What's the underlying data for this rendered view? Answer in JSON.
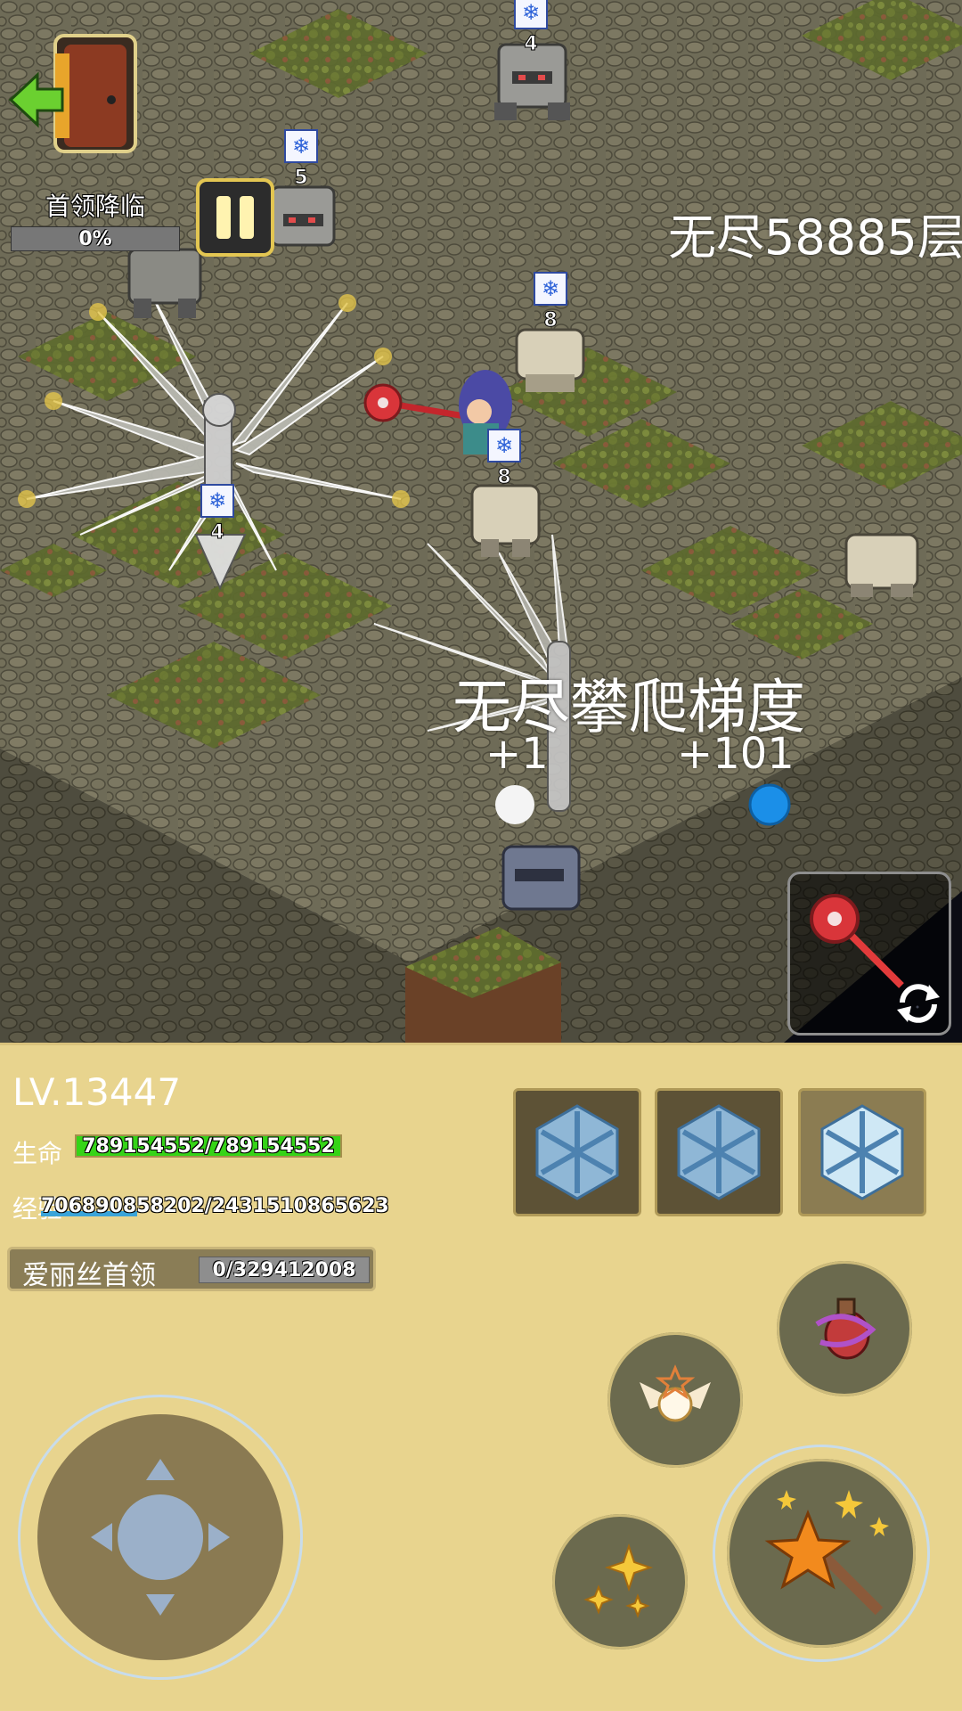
{
  "hud": {
    "boss_arrival_label": "首领降临",
    "boss_arrival_percent": "0%",
    "boss_arrival_progress": 0,
    "floor_label": "无尽58885层"
  },
  "effects": {
    "gradient_label": "无尽攀爬梯度",
    "gain_white": "+1",
    "gain_blue": "+101"
  },
  "enemy_badges": [
    "4",
    "5",
    "8",
    "8",
    "4"
  ],
  "player": {
    "level": "LV.13447",
    "hp_label": "生命",
    "hp_value": "789154552/789154552",
    "hp_fraction": 1.0,
    "exp_label": "经验",
    "exp_value": "706890858202/2431510865623",
    "exp_fraction": 0.29
  },
  "boss": {
    "name": "爱丽丝首领",
    "progress": "0/329412008"
  },
  "skills": [
    {
      "icon": "snowflake-icon",
      "state": "cooldown"
    },
    {
      "icon": "snowflake-icon",
      "state": "cooldown"
    },
    {
      "icon": "snowflake-icon",
      "state": "ready"
    }
  ],
  "colors": {
    "panel_bg": "#e8d48e",
    "hp_green": "#35d417",
    "exp_blue": "#3aa4d9",
    "grass": "#6a7a33",
    "stone": "#6d6a55"
  }
}
